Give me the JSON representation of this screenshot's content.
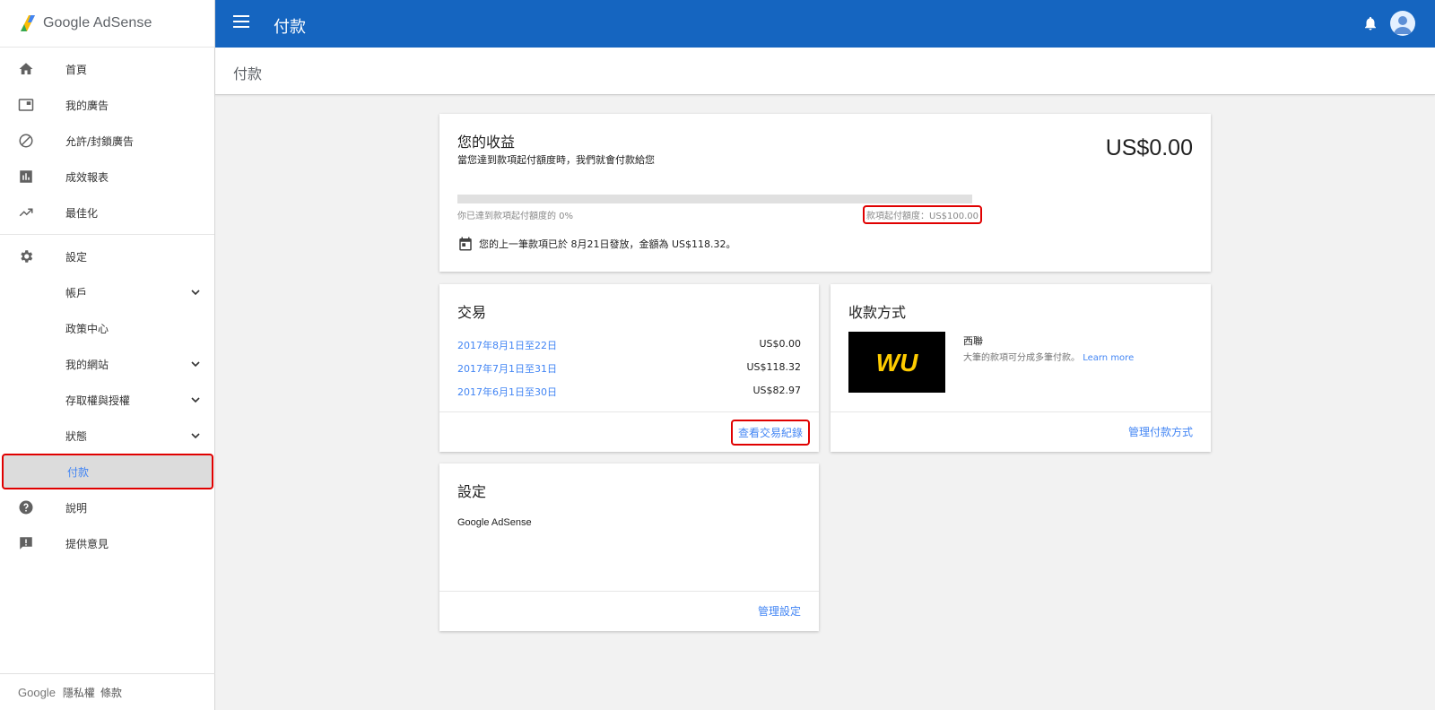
{
  "logo": {
    "text": "Google AdSense"
  },
  "sidebar": {
    "items": [
      {
        "label": "首頁",
        "icon": "home-icon"
      },
      {
        "label": "我的廣告",
        "icon": "ads-icon"
      },
      {
        "label": "允許/封鎖廣告",
        "icon": "block-icon"
      },
      {
        "label": "成效報表",
        "icon": "bar-chart-icon"
      },
      {
        "label": "最佳化",
        "icon": "trending-up-icon"
      }
    ],
    "settings": {
      "label": "設定",
      "icon": "gear-icon",
      "children": [
        {
          "label": "帳戶",
          "expandable": true
        },
        {
          "label": "政策中心",
          "expandable": false
        },
        {
          "label": "我的網站",
          "expandable": true
        },
        {
          "label": "存取權與授權",
          "expandable": true
        },
        {
          "label": "狀態",
          "expandable": true
        },
        {
          "label": "付款",
          "expandable": false,
          "active": true
        }
      ]
    },
    "bottom_items": [
      {
        "label": "說明",
        "icon": "help-icon"
      },
      {
        "label": "提供意見",
        "icon": "feedback-icon"
      }
    ],
    "footer": {
      "brand": "Google",
      "privacy": "隱私權",
      "terms": "條款"
    }
  },
  "topbar": {
    "title": "付款"
  },
  "page_header": {
    "title": "付款"
  },
  "earnings": {
    "title": "您的收益",
    "subtitle": "當您達到款項起付額度時，我們就會付款給您",
    "amount": "US$0.00",
    "progress_fraction": 0.0,
    "progress_left": "你已達到款項起付額度的 0%",
    "threshold": "款項起付額度：US$100.00",
    "last_payment": "您的上一筆款項已於 8月21日發放，金額為 US$118.32。"
  },
  "transactions": {
    "title": "交易",
    "rows": [
      {
        "date": "2017年8月1日至22日",
        "value": "US$0.00"
      },
      {
        "date": "2017年7月1日至31日",
        "value": "US$118.32"
      },
      {
        "date": "2017年6月1日至30日",
        "value": "US$82.97"
      }
    ],
    "view_link": "查看交易紀錄"
  },
  "payment_method": {
    "title": "收款方式",
    "logo_text": "WU",
    "name": "西聯",
    "desc": "大筆的款項可分成多筆付款。",
    "learn_more": "Learn more",
    "manage_link": "管理付款方式"
  },
  "settings_card": {
    "title": "設定",
    "item": "Google AdSense",
    "manage_link": "管理設定"
  },
  "colors": {
    "topbar": "#1565c0",
    "link": "#4285f4",
    "highlight_border": "#e00000",
    "active_bg": "#dcdcdc"
  }
}
